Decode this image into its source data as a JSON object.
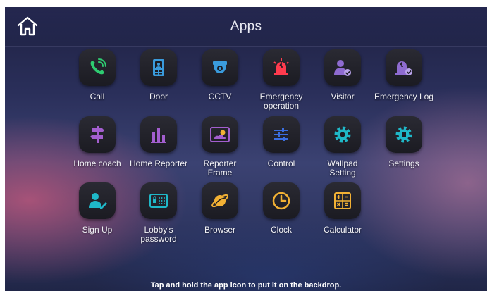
{
  "header": {
    "title": "Apps"
  },
  "apps": [
    {
      "label": "Call"
    },
    {
      "label": "Door"
    },
    {
      "label": "CCTV"
    },
    {
      "label": "Emergency\noperation"
    },
    {
      "label": "Visitor"
    },
    {
      "label": "Emergency Log"
    },
    {
      "label": "Home coach"
    },
    {
      "label": "Home Reporter"
    },
    {
      "label": "Reporter\nFrame"
    },
    {
      "label": "Control"
    },
    {
      "label": "Wallpad\nSetting"
    },
    {
      "label": "Settings"
    },
    {
      "label": "Sign Up"
    },
    {
      "label": "Lobby's\npassword"
    },
    {
      "label": "Browser"
    },
    {
      "label": "Clock"
    },
    {
      "label": "Calculator"
    }
  ],
  "footer": {
    "hint": "Tap and hold the app icon to put it on the backdrop."
  },
  "colors": {
    "call": "#2ecc71",
    "door": "#3a9bdc",
    "cctv": "#3a9bdc",
    "emergency": "#ff3b4e",
    "visitor": "#8e6bd0",
    "emergency_log": "#8e6bd0",
    "home_coach": "#a35ecf",
    "home_reporter": "#a35ecf",
    "reporter_frame": "#a35ecf",
    "control": "#3a6ee0",
    "wallpad": "#1fb8c8",
    "settings": "#1fb8c8",
    "signup": "#1fb8c8",
    "lobby": "#1fb8c8",
    "browser": "#f2b134",
    "clock": "#f2b134",
    "calculator": "#f2b134"
  }
}
